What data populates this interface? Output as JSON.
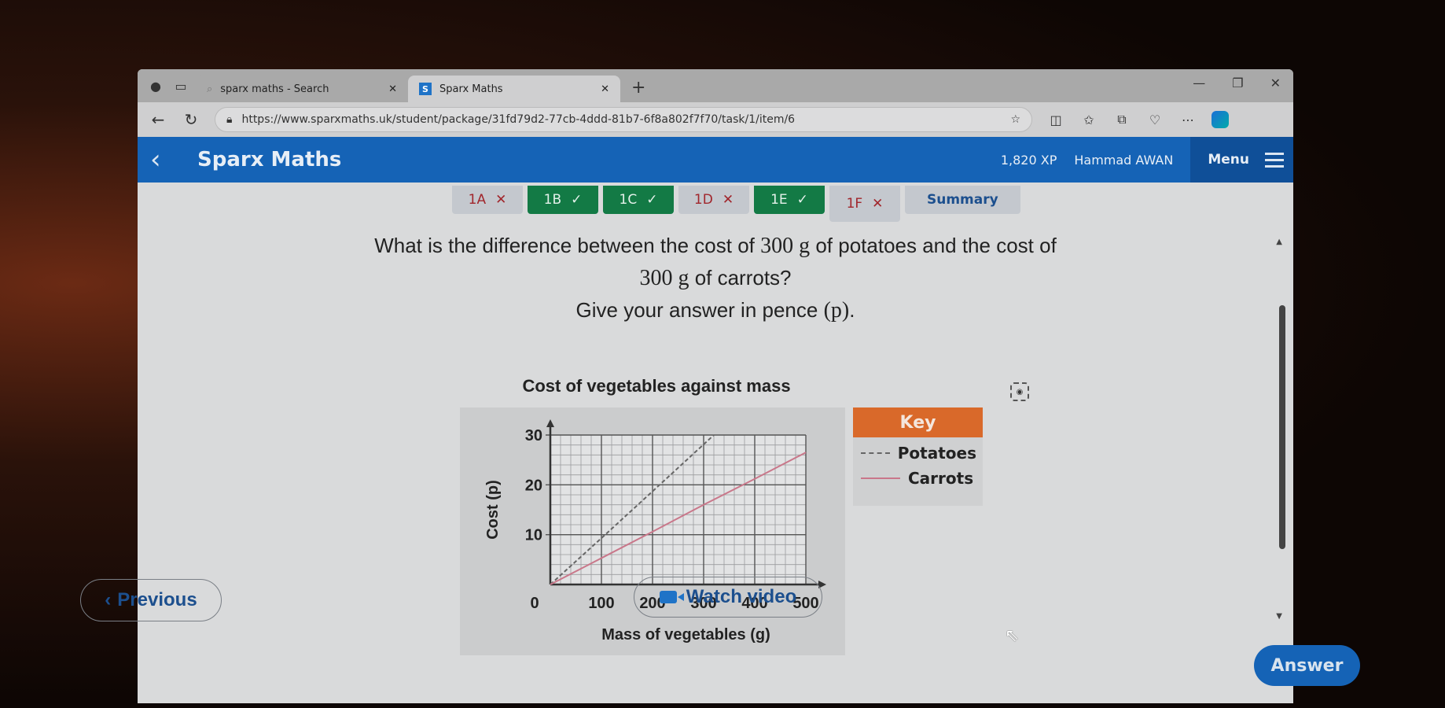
{
  "browser": {
    "tabs": [
      {
        "title": "sparx maths - Search",
        "active": false
      },
      {
        "title": "Sparx Maths",
        "active": true,
        "favicon": "S"
      }
    ],
    "new_tab": "+",
    "url": "https://www.sparxmaths.uk/student/package/31fd79d2-77cb-4ddd-81b7-6f8a802f7f70/task/1/item/6",
    "window_controls": [
      "minimize-icon",
      "restore-icon",
      "close-icon"
    ]
  },
  "header": {
    "title": "Sparx Maths",
    "xp": "1,820 XP",
    "user": "Hammad AWAN",
    "menu_label": "Menu",
    "brand_color": "#1563b6"
  },
  "task_tabs": [
    {
      "label": "1A",
      "status": "wrong",
      "mark": "✕"
    },
    {
      "label": "1B",
      "status": "right",
      "mark": "✓"
    },
    {
      "label": "1C",
      "status": "right",
      "mark": "✓"
    },
    {
      "label": "1D",
      "status": "wrong",
      "mark": "✕"
    },
    {
      "label": "1E",
      "status": "right",
      "mark": "✓"
    },
    {
      "label": "1F",
      "status": "wrong",
      "mark": "✕",
      "current": true
    },
    {
      "label": "Summary",
      "status": "summary"
    }
  ],
  "question": {
    "line1_pre": "What is the difference between the cost of ",
    "line1_math": "300 g",
    "line1_post": " of potatoes and the cost of",
    "line2_math": "300 g",
    "line2_post": " of carrots?",
    "line3_pre": "Give your answer in pence ",
    "line3_math": "(p)",
    "line3_post": "."
  },
  "key": {
    "title": "Key",
    "items": [
      {
        "label": "Potatoes",
        "style": "dashed"
      },
      {
        "label": "Carrots",
        "style": "solid"
      }
    ]
  },
  "chart_data": {
    "type": "line",
    "title": "Cost of vegetables against mass",
    "xlabel": "Mass of vegetables (g)",
    "ylabel": "Cost (p)",
    "xlim": [
      0,
      500
    ],
    "ylim": [
      0,
      30
    ],
    "x_ticks": [
      0,
      100,
      200,
      300,
      400,
      500
    ],
    "y_ticks": [
      0,
      10,
      20,
      30
    ],
    "minor_x_step": 20,
    "minor_y_step": 2,
    "grid": true,
    "legend": "right",
    "series": [
      {
        "name": "Potatoes",
        "style": "dashed",
        "color": "#666666",
        "points": [
          [
            0,
            0
          ],
          [
            100,
            9.3
          ],
          [
            200,
            18.7
          ],
          [
            320,
            30
          ]
        ]
      },
      {
        "name": "Carrots",
        "style": "solid",
        "color": "#c9778a",
        "points": [
          [
            0,
            0
          ],
          [
            100,
            5.3
          ],
          [
            200,
            10.6
          ],
          [
            300,
            16
          ],
          [
            400,
            21.2
          ],
          [
            500,
            26.5
          ]
        ]
      }
    ]
  },
  "buttons": {
    "previous": "Previous",
    "watch_video": "Watch video",
    "answer": "Answer"
  }
}
